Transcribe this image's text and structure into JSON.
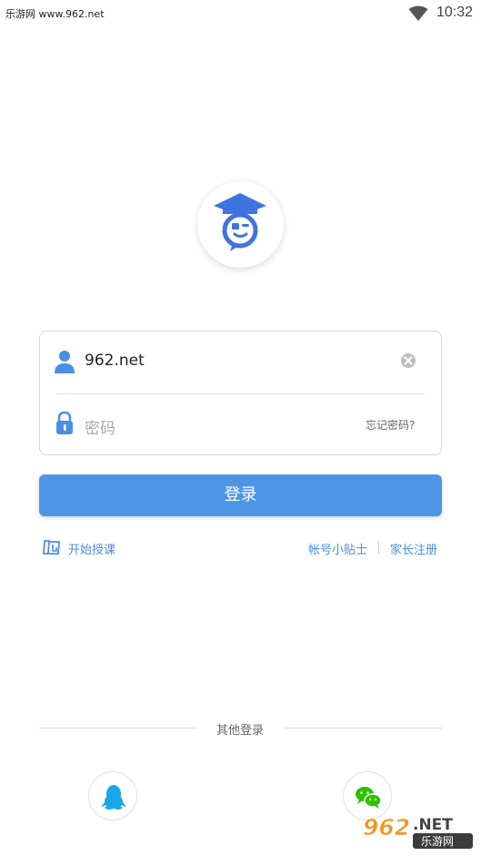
{
  "status_bar": {
    "watermark_text": "乐游网 www.962.net",
    "time": "10:32",
    "wifi_icon": "wifi-icon"
  },
  "logo": {
    "icon": "graduation-cap-chat-icon",
    "accent": "#3f74e0"
  },
  "login_form": {
    "username_value": "962.net",
    "password_placeholder": "密码",
    "forgot_password": "忘记密码?"
  },
  "login_button": {
    "label": "登录",
    "color": "#4d96e6"
  },
  "links": {
    "start_teaching": "开始授课",
    "account_tips": "帐号小贴士",
    "parent_register": "家长注册"
  },
  "other_login": {
    "label": "其他登录",
    "providers": [
      "qq-icon",
      "wechat-icon"
    ]
  },
  "watermark": {
    "brand": "962.NET",
    "subtitle": "乐游网"
  },
  "colors": {
    "link": "#4a8fdb",
    "icon_blue": "#4a90e2",
    "wechat_green": "#2dc100"
  }
}
